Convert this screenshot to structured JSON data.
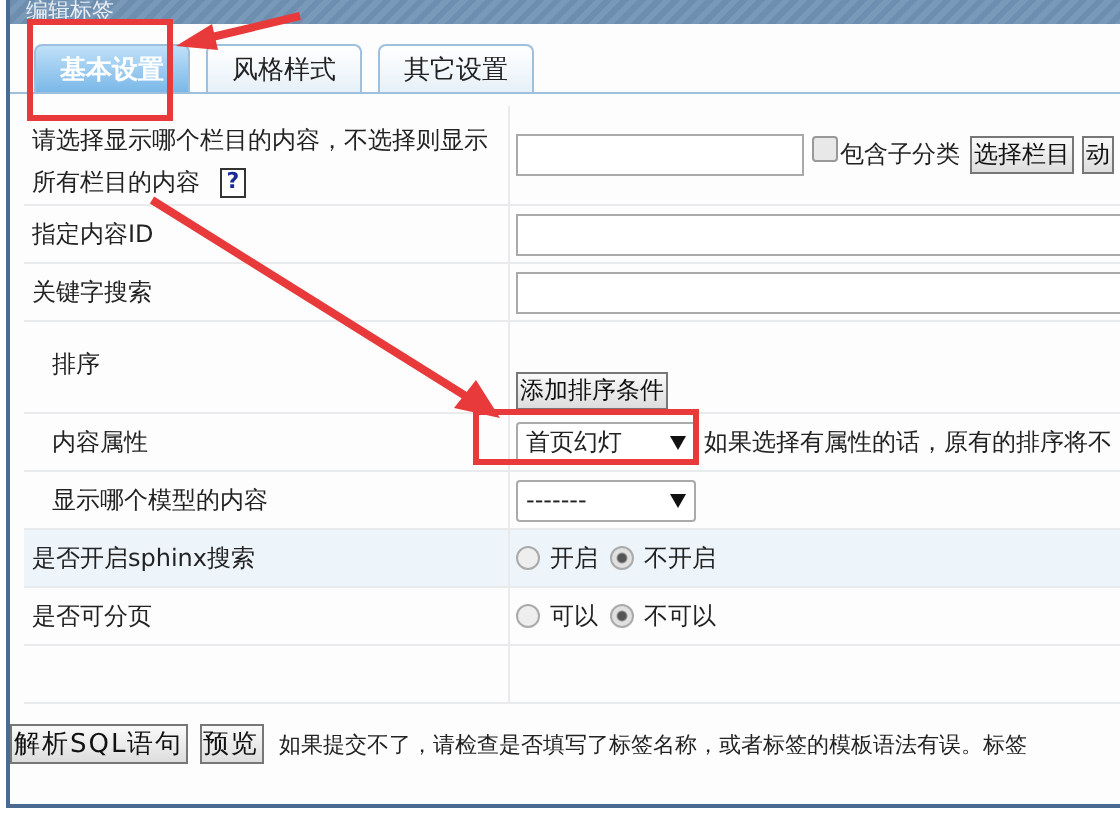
{
  "window": {
    "title": "编辑标签"
  },
  "tabs": [
    {
      "label": "基本设置",
      "selected": true
    },
    {
      "label": "风格样式",
      "selected": false
    },
    {
      "label": "其它设置",
      "selected": false
    }
  ],
  "rows": [
    {
      "kind": "category",
      "label_lines": [
        "请选择显示哪个栏目的内容，不选择则显示",
        "所有栏目的内容"
      ],
      "help": "?",
      "checkbox": {
        "label": "包含子分类",
        "checked": false
      },
      "buttons": [
        "选择栏目",
        "动"
      ]
    },
    {
      "kind": "input",
      "label": "指定内容ID"
    },
    {
      "kind": "input",
      "label": "关键字搜索"
    },
    {
      "kind": "button",
      "label": "排序",
      "button": "添加排序条件"
    },
    {
      "kind": "select",
      "label": "内容属性",
      "value": "首页幻灯",
      "hint": "如果选择有属性的话，原有的排序将不"
    },
    {
      "kind": "select",
      "label": "显示哪个模型的内容",
      "value": "-------"
    },
    {
      "kind": "radio",
      "label": "是否开启sphinx搜索",
      "highlighted": true,
      "options": [
        {
          "label": "开启",
          "selected": false
        },
        {
          "label": "不开启",
          "selected": true
        }
      ]
    },
    {
      "kind": "radio",
      "label": "是否可分页",
      "options": [
        {
          "label": "可以",
          "selected": false
        },
        {
          "label": "不可以",
          "selected": true
        }
      ]
    },
    {
      "kind": "empty"
    }
  ],
  "footer": {
    "buttons": [
      "解析SQL语句",
      "预览"
    ],
    "note": "如果提交不了，请检查是否填写了标签名称，或者标签的模板语法有误。标签"
  }
}
